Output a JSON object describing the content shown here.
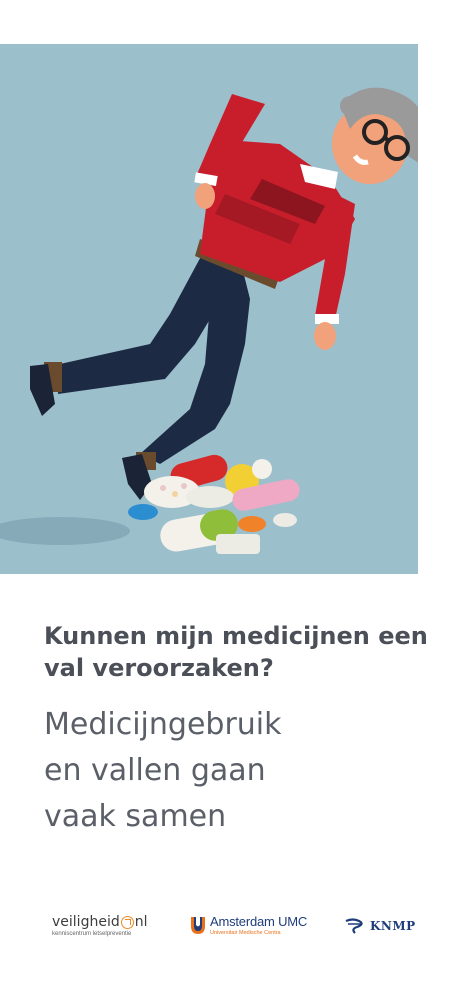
{
  "title": "Kunnen mijn medicijnen een val veroorzaken?",
  "subtitle_lines": [
    "Medicijngebruik",
    "en vallen gaan",
    "vaak samen"
  ],
  "colors": {
    "hero_background": "#9cbfcc",
    "heading": "#4a4f58",
    "sweater": "#c81e2c",
    "trousers": "#1d2a44"
  },
  "logos": {
    "veiligheid": {
      "name_left": "veiligheid",
      "name_right": "nl",
      "tagline": "kenniscentrum letselpreventie"
    },
    "amsterdam_umc": {
      "name": "Amsterdam UMC",
      "tagline": "Universitair Medische Centra"
    },
    "knmp": {
      "name": "KNMP"
    }
  }
}
